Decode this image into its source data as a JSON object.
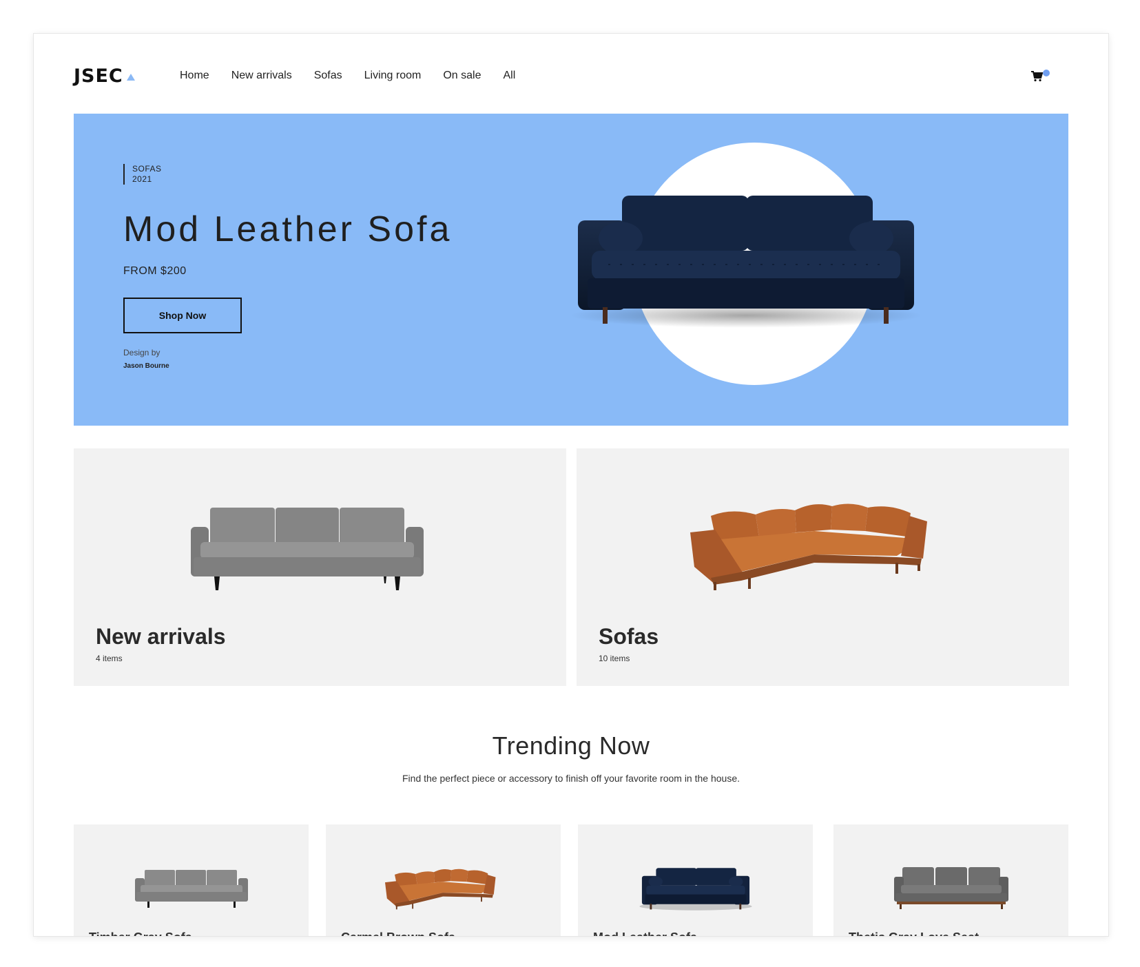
{
  "header": {
    "logo": "JSEC",
    "nav": [
      "Home",
      "New arrivals",
      "Sofas",
      "Living room",
      "On sale",
      "All"
    ],
    "cart_icon": "cart-icon",
    "cart_badge_color": "#6f9ef0"
  },
  "hero": {
    "tag_line1": "SOFAS",
    "tag_line2": "2021",
    "title": "Mod Leather Sofa",
    "price": "FROM $200",
    "button": "Shop Now",
    "design_label": "Design by",
    "designer": "Jason Bourne",
    "background": "#89baf7"
  },
  "categories": [
    {
      "title": "New arrivals",
      "count": "4 items"
    },
    {
      "title": "Sofas",
      "count": "10 items"
    }
  ],
  "trending": {
    "title": "Trending Now",
    "subtitle": "Find the perfect piece or accessory to finish off your favorite room in the house.",
    "products": [
      {
        "name": "Timber Gray Sofa"
      },
      {
        "name": "Carmel Brown Sofa"
      },
      {
        "name": "Mod Leather Sofa"
      },
      {
        "name": "Thetis Gray Love Seat"
      }
    ]
  }
}
